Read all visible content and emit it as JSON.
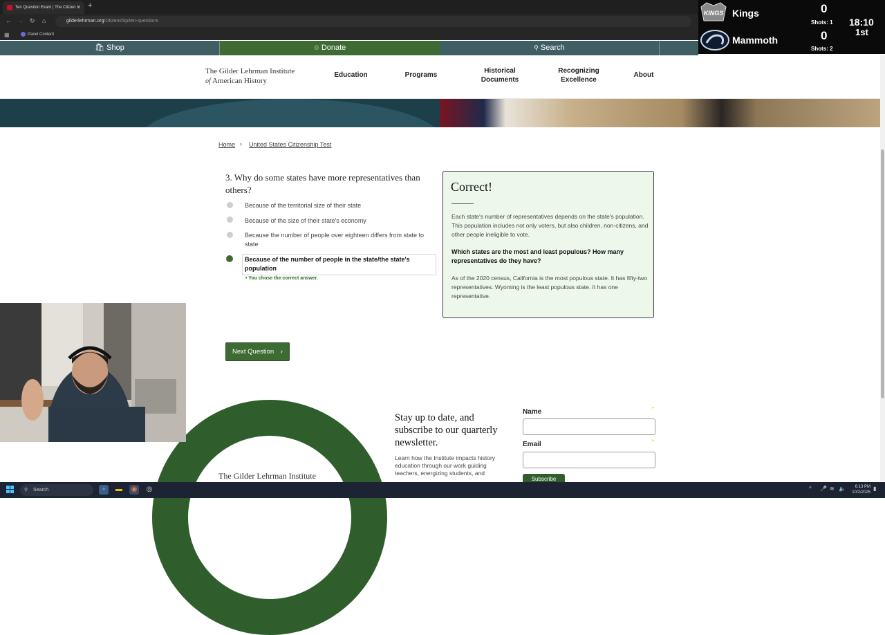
{
  "browser": {
    "tab_title": "Ten Question Exam | The Citizen",
    "url_domain": "gilderlehrman.org",
    "url_path": "/citizenship/ten-questions",
    "bookmark": "Panel Content"
  },
  "scoreboard": {
    "team1": {
      "name": "Kings",
      "score": "0",
      "shots": "Shots: 1",
      "logo": "KINGS"
    },
    "team2": {
      "name": "Mammoth",
      "score": "0",
      "shots": "Shots: 2"
    },
    "clock": "18:10",
    "period": "1st"
  },
  "utility_bar": {
    "shop": "Shop",
    "donate": "Donate",
    "search": "Search"
  },
  "header": {
    "logo_line1": "The Gilder Lehrman Institute",
    "logo_of": "of",
    "logo_line2": "American History",
    "nav": {
      "education": "Education",
      "programs": "Programs",
      "historical_documents": "Historical Documents",
      "recognizing_excellence": "Recognizing Excellence",
      "about": "About"
    }
  },
  "breadcrumb": {
    "home": "Home",
    "current": "United States Citizenship Test",
    "separator": "›"
  },
  "question": {
    "title": "3. Why do some states have more representatives than others?",
    "options": [
      "Because of the territorial size of their state",
      "Because of the size of their state's economy",
      "Because the number of people over eighteen differs from state to state",
      "Because of the number of people in the state/the state's population"
    ],
    "selected_note": "• You chose the correct answer."
  },
  "feedback": {
    "title": "Correct!",
    "para1": "Each state's number of representatives depends on the state's population. This population includes not only voters, but also children, non-citizens, and other people ineligible to vote.",
    "question": "Which states are the most and least populous? How many representatives do they have?",
    "para2": "As of the 2020 census, California is the most populous state. It has fifty-two representatives. Wyoming is the least populous state. It has one representative."
  },
  "next_button": "Next Question",
  "newsletter": {
    "title": "Stay up to date, and subscribe to our quarterly newsletter.",
    "text": "Learn how the Institute impacts history education through our work guiding teachers, energizing students, and",
    "name_label": "Name",
    "email_label": "Email",
    "subscribe": "Subscribe",
    "footer_logo": "The Gilder Lehrman Institute"
  },
  "taskbar": {
    "search": "Search",
    "time": "6:13 PM",
    "date": "10/2/2025"
  },
  "colors": {
    "brand_green": "#3e6b33",
    "teal": "#3f5e64",
    "feedback_bg": "#eef8ea"
  }
}
